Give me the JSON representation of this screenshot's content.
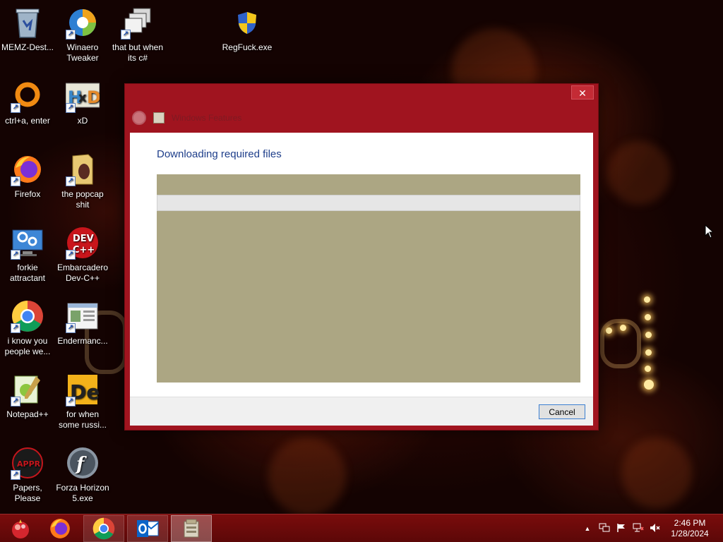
{
  "desktop": {
    "icons": [
      {
        "label": "MEMZ-Dest...",
        "icon": "recycle-bin-icon"
      },
      {
        "label": "Winaero Tweaker",
        "icon": "winaero-icon"
      },
      {
        "label": "that but when its c#",
        "icon": "windows-stack-icon"
      },
      {
        "label": "RegFuck.exe",
        "icon": "uac-shield-icon"
      },
      {
        "label": "ctrl+a, enter",
        "icon": "ring-icon"
      },
      {
        "label": "xD",
        "icon": "hxd-icon"
      },
      {
        "label": "Firefox",
        "icon": "firefox-icon"
      },
      {
        "label": "the popcap shit",
        "icon": "folder-icon"
      },
      {
        "label": "forkie attractant",
        "icon": "computer-settings-icon"
      },
      {
        "label": "Embarcadero Dev-C++",
        "icon": "devcpp-icon"
      },
      {
        "label": "i know you people we...",
        "icon": "chrome-icon"
      },
      {
        "label": "Endermanc...",
        "icon": "window-app-icon"
      },
      {
        "label": "Notepad++",
        "icon": "notepadpp-icon"
      },
      {
        "label": "for when some russi...",
        "icon": "de-icon"
      },
      {
        "label": "Papers, Please",
        "icon": "papers-please-icon"
      },
      {
        "label": "Forza Horizon 5.exe",
        "icon": "flash-icon"
      }
    ]
  },
  "dialog": {
    "title": "Windows Features",
    "heading": "Downloading required files",
    "progress": 0,
    "cancel_label": "Cancel",
    "close_glyph": "✕"
  },
  "taskbar": {
    "buttons": [
      {
        "name": "start",
        "icon": "start-orb-icon"
      },
      {
        "name": "firefox",
        "icon": "firefox-icon"
      },
      {
        "name": "chrome",
        "icon": "chrome-icon"
      },
      {
        "name": "outlook",
        "icon": "outlook-icon"
      },
      {
        "name": "windows-features",
        "icon": "windows-features-icon"
      }
    ],
    "tray_chevron": "▲",
    "time": "2:46 PM",
    "date": "1/28/2024"
  },
  "colors": {
    "dialog_frame": "#a0141f",
    "heading_text": "#1e3e8a",
    "panel": "#aca683",
    "taskbar": "#6b0a0a"
  }
}
